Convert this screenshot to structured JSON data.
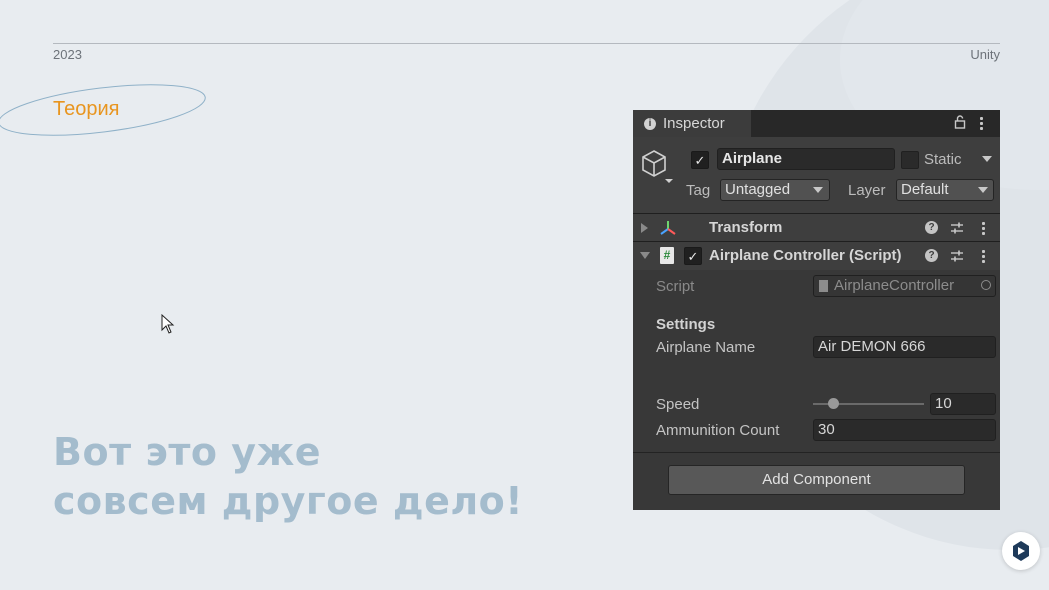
{
  "slide": {
    "year": "2023",
    "brand": "Unity",
    "section": "Теория",
    "headline_line1": "Вот это уже",
    "headline_line2": "совсем другое дело!"
  },
  "colors": {
    "background": "#e8ecf0",
    "accent_orange": "#e8951f",
    "headline": "#a4bccd",
    "inspector_bg": "#383838"
  },
  "inspector": {
    "tab_label": "Inspector",
    "object": {
      "active": true,
      "name": "Airplane",
      "static_checked": false,
      "static_label": "Static",
      "tag_label": "Tag",
      "tag_value": "Untagged",
      "layer_label": "Layer",
      "layer_value": "Default"
    },
    "components": [
      {
        "title": "Transform",
        "expanded": false
      },
      {
        "title": "Airplane Controller (Script)",
        "expanded": true,
        "enabled": true
      }
    ],
    "script": {
      "label": "Script",
      "value": "AirplaneController"
    },
    "settings_title": "Settings",
    "fields": {
      "airplane_name_label": "Airplane Name",
      "airplane_name_value": "Air DEMON 666",
      "speed_label": "Speed",
      "speed_value": "10",
      "speed_slider_fraction": 0.15,
      "ammo_label": "Ammunition Count",
      "ammo_value": "30"
    },
    "add_component_label": "Add Component"
  }
}
